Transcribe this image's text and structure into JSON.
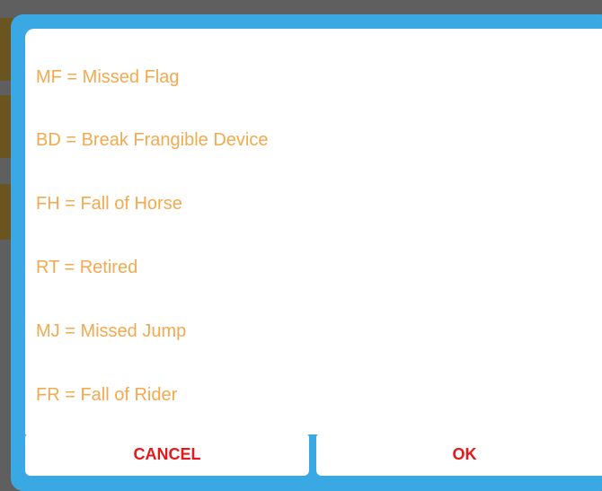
{
  "dialog": {
    "items": [
      "MF = Missed Flag",
      "BD = Break Frangible Device",
      "FH = Fall of Horse",
      "RT = Retired",
      "MJ = Missed Jump",
      "FR = Fall of Rider"
    ],
    "cancel_label": "CANCEL",
    "ok_label": "OK"
  },
  "colors": {
    "accent": "#3aa9e3",
    "item_text": "#f4a94e",
    "button_text": "#e5191c"
  }
}
